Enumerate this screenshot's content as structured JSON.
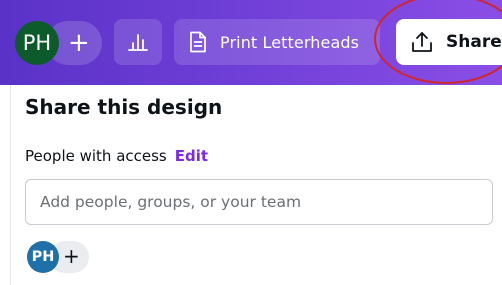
{
  "topbar": {
    "avatar_initials": "PH",
    "add_symbol": "+",
    "insights_icon": "bar-chart-icon",
    "print_button": {
      "icon": "document-icon",
      "label": "Print Letterheads"
    },
    "share_button": {
      "icon": "upload-icon",
      "label": "Share"
    },
    "colors": {
      "gradient_start": "#5a32c8",
      "gradient_end": "#8a4ee6",
      "avatar_bg": "#0d5a2a",
      "highlight_ring": "#d0262a"
    }
  },
  "share_panel": {
    "title": "Share this design",
    "access_label": "People with access",
    "edit_label": "Edit",
    "invite_placeholder": "Add people, groups, or your team",
    "member_initials": "PH",
    "member_add_symbol": "+",
    "colors": {
      "edit_link": "#7d2ae8",
      "member_avatar_bg": "#1f6fa8"
    }
  }
}
